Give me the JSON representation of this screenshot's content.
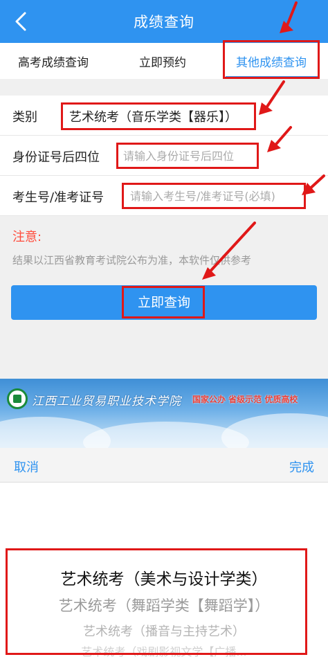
{
  "header": {
    "title": "成绩查询"
  },
  "tabs": [
    {
      "label": "高考成绩查询"
    },
    {
      "label": "立即预约"
    },
    {
      "label": "其他成绩查询",
      "active": true
    }
  ],
  "form": {
    "category": {
      "label": "类别",
      "value": "艺术统考（音乐学类【器乐】）"
    },
    "id_last4": {
      "label": "身份证号后四位",
      "placeholder": "请输入身份证号后四位"
    },
    "exam_no": {
      "label": "考生号/准考证号",
      "placeholder": "请输入考生号/准考证号(必填)"
    }
  },
  "notice": {
    "title": "注意:",
    "text": "结果以江西省教育考试院公布为准，本软件仅供参考"
  },
  "query_button": "立即查询",
  "banner": {
    "school_name": "江西工业贸易职业技术学院",
    "slogan": "国家公办  省级示范  优质高校"
  },
  "picker": {
    "cancel": "取消",
    "done": "完成",
    "options": [
      "艺术统考（美术与设计学类）",
      "艺术统考（舞蹈学类【舞蹈学】）",
      "艺术统考（播音与主持艺术）",
      "艺术统考（戏剧影视文学【广播..."
    ]
  },
  "colors": {
    "accent": "#2f93f0",
    "warning": "#ff4a3a",
    "annotation": "#e01818"
  }
}
